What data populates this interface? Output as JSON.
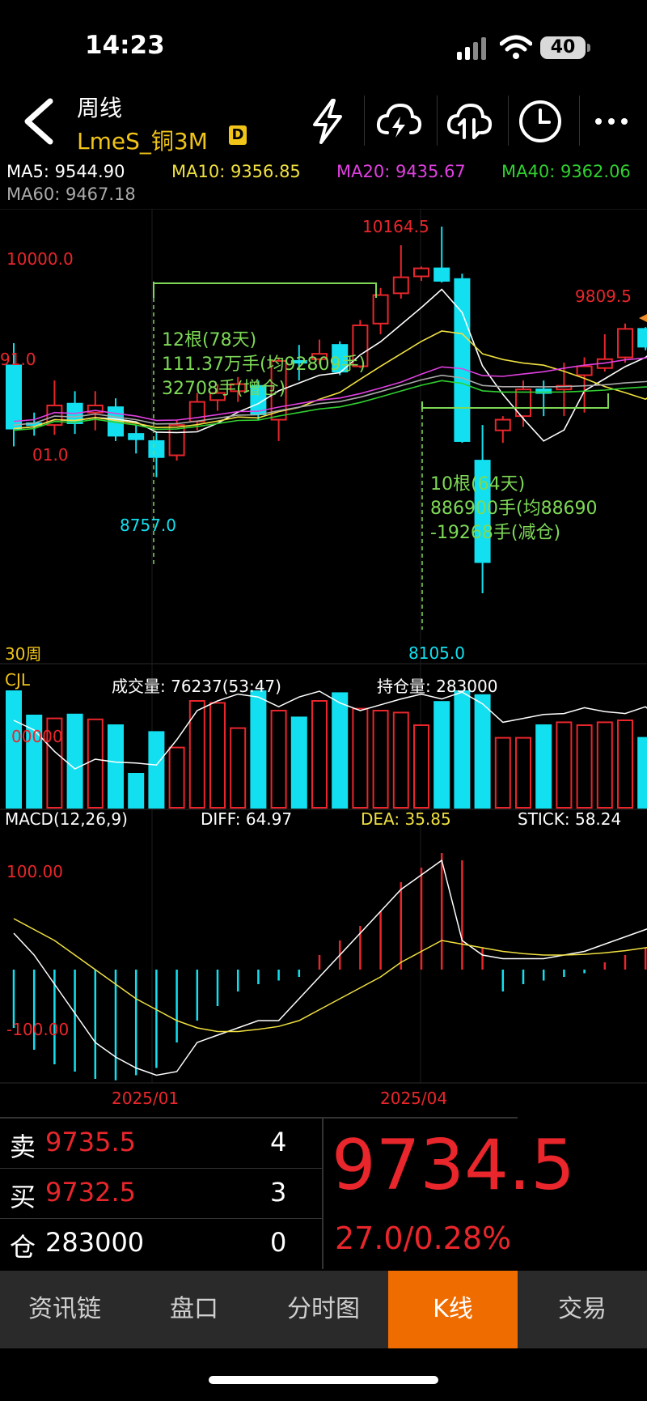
{
  "status": {
    "time": "14:23",
    "battery": "40"
  },
  "header": {
    "period": "周线",
    "symbol": "LmeS_铜3M",
    "badge": "D",
    "icons": [
      "back-arrow-icon",
      "lightning-icon",
      "cloud-lightning-icon",
      "cloud-sync-icon",
      "clock-icon",
      "more-icon"
    ]
  },
  "ma": {
    "ma5": "MA5: 9544.90",
    "ma10": "MA10: 9356.85",
    "ma20": "MA20: 9435.67",
    "ma40": "MA40: 9362.06",
    "ma60": "MA60: 9467.18"
  },
  "price_panel": {
    "label_10000": "10000.0",
    "label_left_mid": "91.0",
    "label_left_low": "01.0",
    "high_label": "10164.5",
    "low_label": "8105.0",
    "low_label_2": "8757.0",
    "recent_high": "9809.5",
    "period_count": "30周",
    "box1": {
      "line1": "12根(78天)",
      "line2": "111.37万手(均92809手)",
      "line3": "32708手(增仓)"
    },
    "box2": {
      "line1": "10根(64天)",
      "line2": "886900手(均88690",
      "line3": "-19268手(减仓)"
    }
  },
  "volume_panel": {
    "label": "CJL",
    "volume": "成交量: 76237(53:47)",
    "open_interest": "持仓量: 283000",
    "axis": "00000"
  },
  "macd_panel": {
    "label": "MACD(12,26,9)",
    "diff": "DIFF: 64.97",
    "dea": "DEA: 35.85",
    "stick": "STICK: 58.24",
    "axis_top": "100.00",
    "axis_bottom": "-100.00"
  },
  "dates": [
    "2025/01",
    "2025/04"
  ],
  "quote": {
    "sell_label": "卖",
    "sell_price": "9735.5",
    "sell_qty": "4",
    "buy_label": "买",
    "buy_price": "9732.5",
    "buy_qty": "3",
    "pos_label": "仓",
    "pos_value": "283000",
    "pos_qty": "0",
    "last": "9734.5",
    "change": "27.0/0.28%"
  },
  "tabs": [
    "资讯链",
    "盘口",
    "分时图",
    "K线",
    "交易"
  ],
  "colors": {
    "up": "#e8262b",
    "down": "#12e0f0",
    "ma5": "#ffffff",
    "ma10": "#f0e040",
    "ma20": "#e040e0",
    "ma40": "#30d030",
    "ma60": "#aaaaaa",
    "accent": "#ef6c00"
  },
  "chart_data": [
    {
      "type": "candlestick",
      "title": "LmeS_铜3M 周线",
      "series": [
        {
          "o": 9385,
          "h": 9510,
          "l": 8930,
          "c": 9030
        },
        {
          "o": 9060,
          "h": 9120,
          "l": 8990,
          "c": 9050
        },
        {
          "o": 9050,
          "h": 9300,
          "l": 8995,
          "c": 9160
        },
        {
          "o": 9170,
          "h": 9240,
          "l": 9000,
          "c": 9060
        },
        {
          "o": 9120,
          "h": 9240,
          "l": 9020,
          "c": 9160
        },
        {
          "o": 9150,
          "h": 9200,
          "l": 8960,
          "c": 8990
        },
        {
          "o": 9000,
          "h": 9050,
          "l": 8890,
          "c": 8970
        },
        {
          "o": 8960,
          "h": 9010,
          "l": 8757,
          "c": 8870
        },
        {
          "o": 8880,
          "h": 9080,
          "l": 8850,
          "c": 9050
        },
        {
          "o": 9070,
          "h": 9230,
          "l": 9020,
          "c": 9180
        },
        {
          "o": 9190,
          "h": 9280,
          "l": 9130,
          "c": 9230
        },
        {
          "o": 9240,
          "h": 9320,
          "l": 9180,
          "c": 9280
        },
        {
          "o": 9270,
          "h": 9300,
          "l": 9080,
          "c": 9110
        },
        {
          "o": 9080,
          "h": 9430,
          "l": 8960,
          "c": 9410
        },
        {
          "o": 9410,
          "h": 9500,
          "l": 9300,
          "c": 9400
        },
        {
          "o": 9420,
          "h": 9530,
          "l": 9390,
          "c": 9450
        },
        {
          "o": 9500,
          "h": 9520,
          "l": 9330,
          "c": 9350
        },
        {
          "o": 9380,
          "h": 9640,
          "l": 9370,
          "c": 9610
        },
        {
          "o": 9620,
          "h": 9820,
          "l": 9560,
          "c": 9780
        },
        {
          "o": 9790,
          "h": 10060,
          "l": 9760,
          "c": 9880
        },
        {
          "o": 9885,
          "h": 9940,
          "l": 9860,
          "c": 9930
        },
        {
          "o": 9930,
          "h": 10164.5,
          "l": 9850,
          "c": 9860
        },
        {
          "o": 9870,
          "h": 9900,
          "l": 8950,
          "c": 8960
        },
        {
          "o": 8850,
          "h": 9050,
          "l": 8105,
          "c": 8280
        },
        {
          "o": 9020,
          "h": 9100,
          "l": 8950,
          "c": 9080
        },
        {
          "o": 9100,
          "h": 9300,
          "l": 9040,
          "c": 9250
        },
        {
          "o": 9250,
          "h": 9300,
          "l": 9100,
          "c": 9230
        },
        {
          "o": 9250,
          "h": 9400,
          "l": 9100,
          "c": 9270
        },
        {
          "o": 9330,
          "h": 9430,
          "l": 9120,
          "c": 9380
        },
        {
          "o": 9370,
          "h": 9560,
          "l": 9350,
          "c": 9420
        },
        {
          "o": 9430,
          "h": 9620,
          "l": 9400,
          "c": 9590
        },
        {
          "o": 9590,
          "h": 9600,
          "l": 9470,
          "c": 9490
        },
        {
          "o": 9580,
          "h": 9809.5,
          "l": 9540,
          "c": 9734.5
        }
      ]
    },
    {
      "type": "bar",
      "title": "CJL",
      "values": [
        120000,
        95000,
        92000,
        96000,
        91000,
        85000,
        35000,
        78000,
        62000,
        110000,
        108000,
        82000,
        120000,
        100000,
        93000,
        110000,
        118000,
        102000,
        100000,
        98000,
        85000,
        109000,
        120000,
        116000,
        72000,
        72000,
        85000,
        88000,
        85000,
        88000,
        90000,
        72000,
        85000
      ],
      "oi_line": [
        90000,
        80000,
        58000,
        40000,
        50000,
        47000,
        46000,
        44000,
        70000,
        100000,
        110000,
        117000,
        114000,
        104000,
        114000,
        120000,
        108000,
        100000,
        106000,
        112000,
        117000,
        112000,
        119000,
        107000,
        88000,
        92000,
        96000,
        97000,
        103000,
        99000,
        97000,
        104000,
        85000
      ]
    },
    {
      "type": "bar",
      "title": "MACD(12,26,9)",
      "stick": [
        -80,
        -110,
        -130,
        -140,
        -150,
        -152,
        -145,
        -135,
        -100,
        -70,
        -50,
        -30,
        -20,
        -15,
        -10,
        20,
        40,
        60,
        80,
        120,
        140,
        160,
        150,
        30,
        -30,
        -20,
        -15,
        -10,
        -5,
        10,
        20,
        30,
        58.24
      ],
      "diff": [
        50,
        20,
        -20,
        -60,
        -100,
        -120,
        -135,
        -145,
        -140,
        -100,
        -90,
        -80,
        -70,
        -70,
        -40,
        -10,
        20,
        50,
        80,
        110,
        130,
        150,
        40,
        20,
        15,
        15,
        15,
        20,
        25,
        35,
        45,
        55,
        64.97
      ],
      "dea": [
        70,
        55,
        40,
        20,
        0,
        -20,
        -40,
        -55,
        -70,
        -80,
        -85,
        -85,
        -82,
        -78,
        -70,
        -55,
        -40,
        -25,
        -10,
        10,
        25,
        40,
        35,
        30,
        25,
        22,
        20,
        20,
        21,
        23,
        26,
        30,
        35.85
      ],
      "ylim": [
        -150,
        200
      ]
    }
  ]
}
